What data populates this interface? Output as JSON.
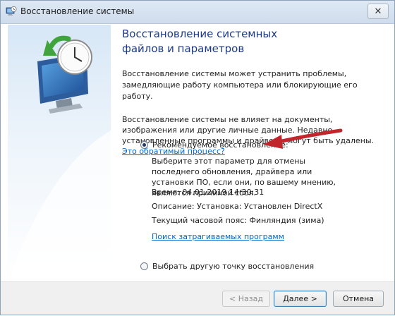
{
  "window": {
    "title": "Восстановление системы",
    "close_symbol": "✕"
  },
  "main": {
    "heading": "Восстановление системных файлов и параметров",
    "intro": "Восстановление системы может устранить проблемы, замедляющие работу компьютера или блокирующие его работу.",
    "warning": "Восстановление системы не влияет на документы, изображения или другие личные данные. Недавно установленные программы и драйверы могут быть удалены.",
    "undo_link": "Это обратимый процесс?"
  },
  "recommended": {
    "label": "Рекомендуемое восстановление:",
    "selected": true,
    "description": "Выберите этот параметр для отмены последнего обновления, драйвера или установки ПО, если они, по вашему мнению, являются причиной сбоя.",
    "time": "Время: 04.01.2019 14:30:31",
    "desc_line": "Описание: Установка: Установлен DirectX",
    "timezone": "Текущий часовой пояс: Финляндия (зима)",
    "affected_link": "Поиск затрагиваемых программ"
  },
  "other": {
    "label": "Выбрать другую точку восстановления",
    "selected": false
  },
  "buttons": {
    "back": "< Назад",
    "next": "Далее >",
    "cancel": "Отмена"
  },
  "colors": {
    "heading": "#1d3a87",
    "link": "#0066cc",
    "arrow": "#c0262b"
  },
  "icons": [
    "restore-app-icon",
    "close-icon",
    "computer-restore-icon",
    "red-arrow-icon"
  ]
}
